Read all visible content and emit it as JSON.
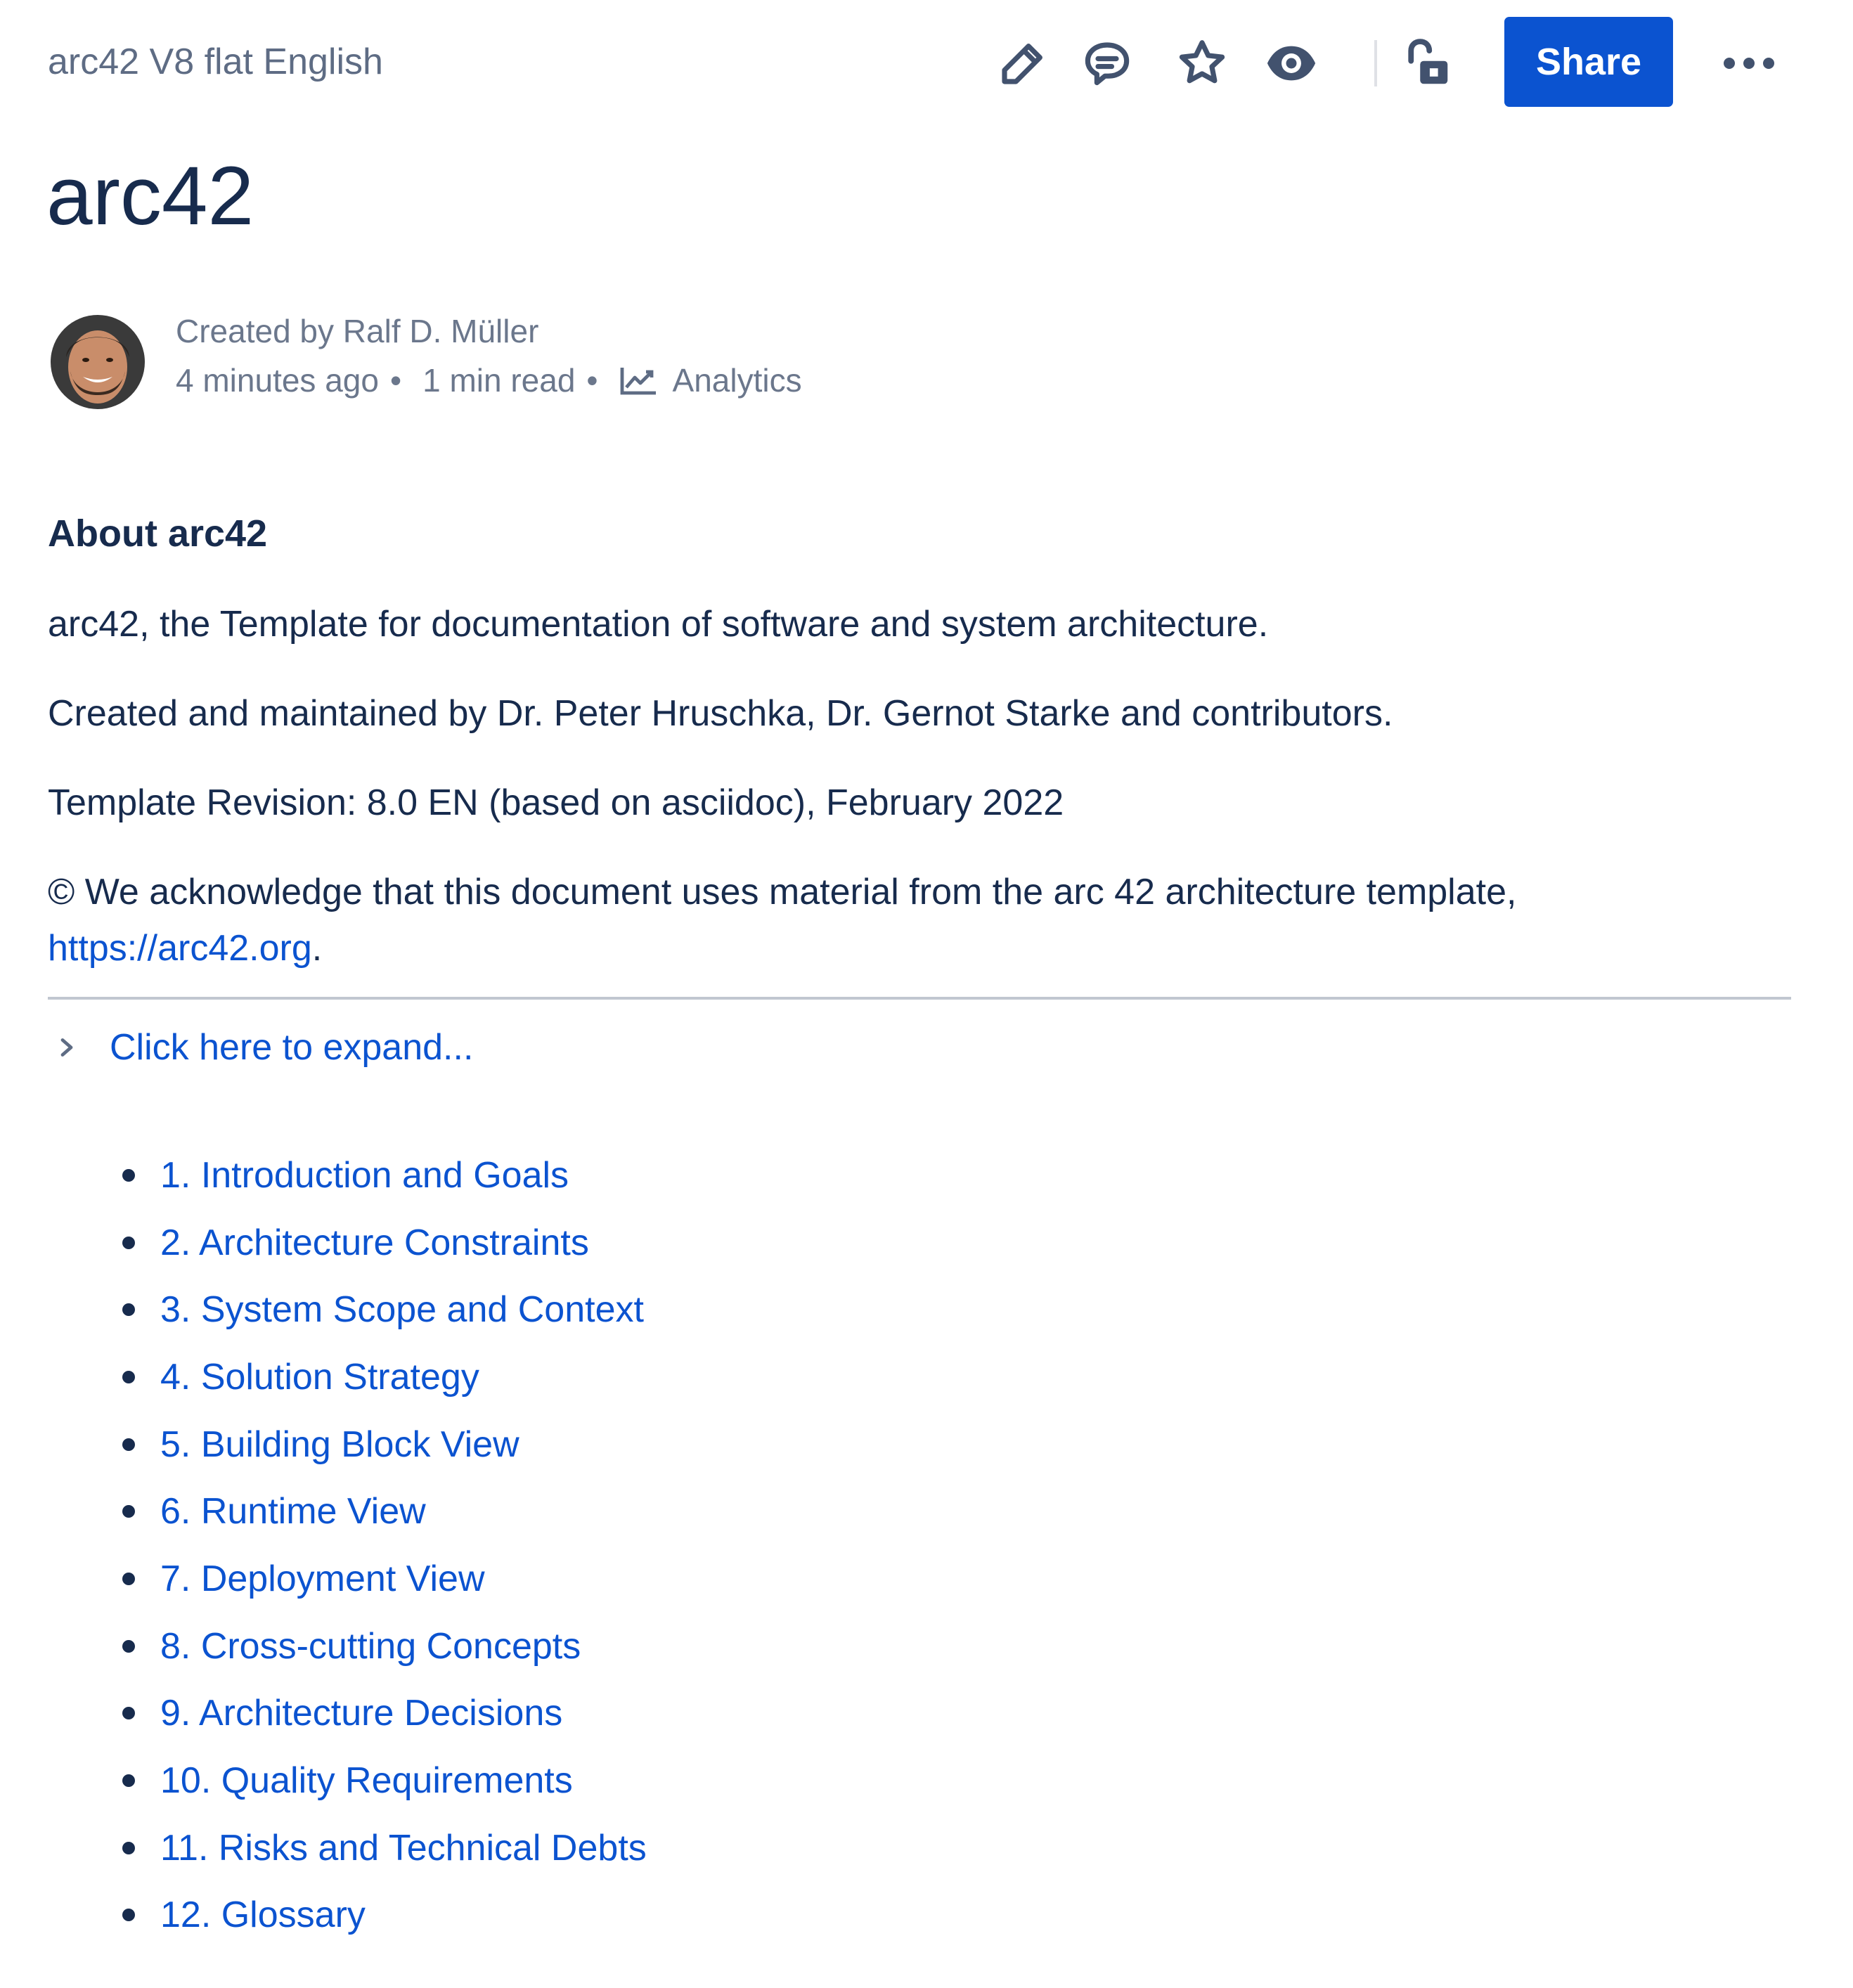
{
  "header": {
    "breadcrumb": "arc42 V8 flat English",
    "share_label": "Share",
    "icons": [
      "edit-icon",
      "comment-icon",
      "star-icon",
      "watch-icon",
      "unlock-icon",
      "more-icon"
    ],
    "accent_color": "#0b53d0"
  },
  "page": {
    "title": "arc42"
  },
  "byline": {
    "created_by": "Created by Ralf D. Müller",
    "time_ago": "4 minutes ago",
    "read_time": "1 min read",
    "analytics": "Analytics",
    "separator": "•"
  },
  "content": {
    "heading": "About arc42",
    "para1": "arc42, the Template for documentation of software and system architecture.",
    "para2": "Created and maintained by Dr. Peter Hruschka, Dr. Gernot Starke and contributors.",
    "para3": "Template Revision: 8.0 EN (based on asciidoc), February 2022",
    "para4_text": "© We acknowledge that this document uses material from the arc 42 architecture template,",
    "para4_link": "https://arc42.org",
    "para4_end": ".",
    "expand_label": "Click here to expand..."
  },
  "toc": {
    "items": [
      "1. Introduction and Goals",
      "2. Architecture Constraints",
      "3. System Scope and Context",
      "4. Solution Strategy",
      "5. Building Block View",
      "6. Runtime View",
      "7. Deployment View",
      "8. Cross-cutting Concepts",
      "9. Architecture Decisions",
      "10. Quality Requirements",
      "11. Risks and Technical Debts",
      "12. Glossary"
    ]
  }
}
